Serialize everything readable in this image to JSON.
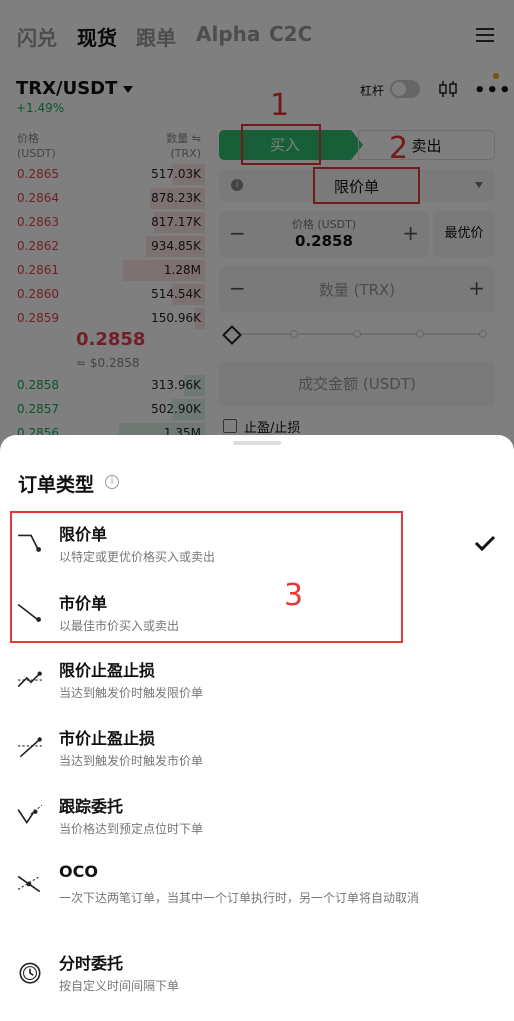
{
  "nav": {
    "tabs": [
      "闪兑",
      "现货",
      "跟单",
      "Alpha",
      "C2C"
    ],
    "active": "现货"
  },
  "pair": {
    "symbol": "TRX/USDT",
    "change": "+1.49%",
    "leverage_label": "杠杆"
  },
  "orderbook": {
    "price_header": "价格",
    "price_unit": "(USDT)",
    "qty_header": "数量 ⇋",
    "qty_unit": "(TRX)",
    "asks": [
      {
        "price": "0.2865",
        "qty": "517.03K",
        "depth": 0.16
      },
      {
        "price": "0.2864",
        "qty": "878.23K",
        "depth": 0.27
      },
      {
        "price": "0.2863",
        "qty": "817.17K",
        "depth": 0.25
      },
      {
        "price": "0.2862",
        "qty": "934.85K",
        "depth": 0.29
      },
      {
        "price": "0.2861",
        "qty": "1.28M",
        "depth": 0.4
      },
      {
        "price": "0.2860",
        "qty": "514.54K",
        "depth": 0.16
      },
      {
        "price": "0.2859",
        "qty": "150.96K",
        "depth": 0.05
      }
    ],
    "last_price": "0.2858",
    "last_price_fiat": "≈ $0.2858",
    "bids": [
      {
        "price": "0.2858",
        "qty": "313.96K",
        "depth": 0.1
      },
      {
        "price": "0.2857",
        "qty": "502.90K",
        "depth": 0.16
      },
      {
        "price": "0.2856",
        "qty": "1.35M",
        "depth": 0.42
      }
    ]
  },
  "order_panel": {
    "buy_label": "买入",
    "sell_label": "卖出",
    "order_type": "限价单",
    "price_label": "价格 (USDT)",
    "price_value": "0.2858",
    "best_price_label": "最优价",
    "qty_placeholder": "数量 (TRX)",
    "amount_placeholder": "成交金额 (USDT)",
    "tpsl_label": "止盈/止损",
    "minus": "−",
    "plus": "+"
  },
  "annotations": [
    "1",
    "2",
    "3"
  ],
  "sheet": {
    "title": "订单类型",
    "selected": "限价单",
    "options": [
      {
        "name": "限价单",
        "desc": "以特定或更优价格买入或卖出",
        "icon": "limit-order-icon"
      },
      {
        "name": "市价单",
        "desc": "以最佳市价买入或卖出",
        "icon": "market-order-icon"
      },
      {
        "name": "限价止盈止损",
        "desc": "当达到触发价时触发限价单",
        "icon": "limit-tpsl-icon"
      },
      {
        "name": "市价止盈止损",
        "desc": "当达到触发价时触发市价单",
        "icon": "market-tpsl-icon"
      },
      {
        "name": "跟踪委托",
        "desc": "当价格达到预定点位时下单",
        "icon": "trailing-order-icon"
      },
      {
        "name": "OCO",
        "desc": "一次下达两笔订单，当其中一个订单执行时，另一个订单将自动取消",
        "icon": "oco-icon"
      },
      {
        "name": "分时委托",
        "desc": "按自定义时间间隔下单",
        "icon": "twap-clock-icon"
      }
    ]
  },
  "colors": {
    "buy": "#2ebd72",
    "sell": "#e0414c",
    "annotation": "#e53935"
  }
}
